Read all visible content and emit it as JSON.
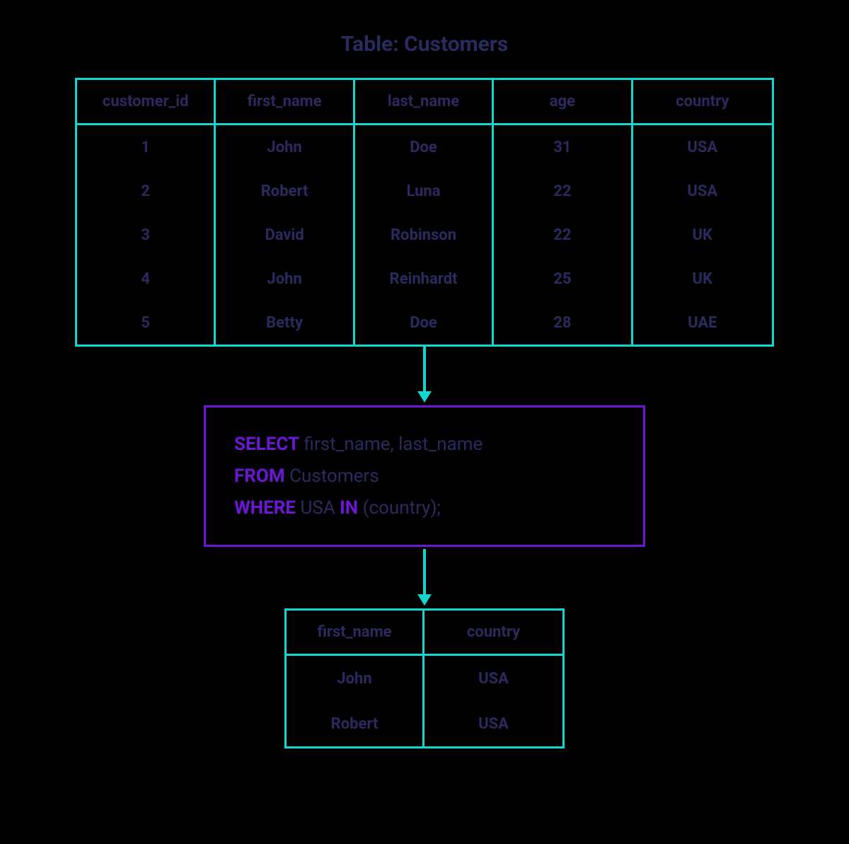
{
  "title": "Table: Customers",
  "main_table": {
    "columns": [
      "customer_id",
      "first_name",
      "last_name",
      "age",
      "country"
    ],
    "rows": [
      {
        "customer_id": "1",
        "first_name": "John",
        "last_name": "Doe",
        "age": "31",
        "country": "USA"
      },
      {
        "customer_id": "2",
        "first_name": "Robert",
        "last_name": "Luna",
        "age": "22",
        "country": "USA"
      },
      {
        "customer_id": "3",
        "first_name": "David",
        "last_name": "Robinson",
        "age": "22",
        "country": "UK"
      },
      {
        "customer_id": "4",
        "first_name": "John",
        "last_name": "Reinhardt",
        "age": "25",
        "country": "UK"
      },
      {
        "customer_id": "5",
        "first_name": "Betty",
        "last_name": "Doe",
        "age": "28",
        "country": "UAE"
      }
    ]
  },
  "sql": {
    "line1": {
      "kw": "SELECT",
      "rest": " first_name, last_name"
    },
    "line2": {
      "kw": "FROM",
      "rest": " Customers"
    },
    "line3": {
      "kw1": "WHERE",
      "mid": " USA ",
      "kw2": "IN",
      "rest": " (country);"
    }
  },
  "result_table": {
    "columns": [
      "first_name",
      "country"
    ],
    "rows": [
      {
        "first_name": "John",
        "country": "USA"
      },
      {
        "first_name": "Robert",
        "country": "USA"
      }
    ]
  },
  "chart_data": {
    "type": "table",
    "description": "SQL IN-operator diagram: source Customers table, query, and filtered result",
    "source_table": {
      "name": "Customers",
      "columns": [
        "customer_id",
        "first_name",
        "last_name",
        "age",
        "country"
      ],
      "rows": [
        [
          1,
          "John",
          "Doe",
          31,
          "USA"
        ],
        [
          2,
          "Robert",
          "Luna",
          22,
          "USA"
        ],
        [
          3,
          "David",
          "Robinson",
          22,
          "UK"
        ],
        [
          4,
          "John",
          "Reinhardt",
          25,
          "UK"
        ],
        [
          5,
          "Betty",
          "Doe",
          28,
          "UAE"
        ]
      ]
    },
    "query": "SELECT first_name, last_name FROM Customers WHERE USA IN (country);",
    "result": {
      "columns": [
        "first_name",
        "country"
      ],
      "rows": [
        [
          "John",
          "USA"
        ],
        [
          "Robert",
          "USA"
        ]
      ]
    }
  }
}
